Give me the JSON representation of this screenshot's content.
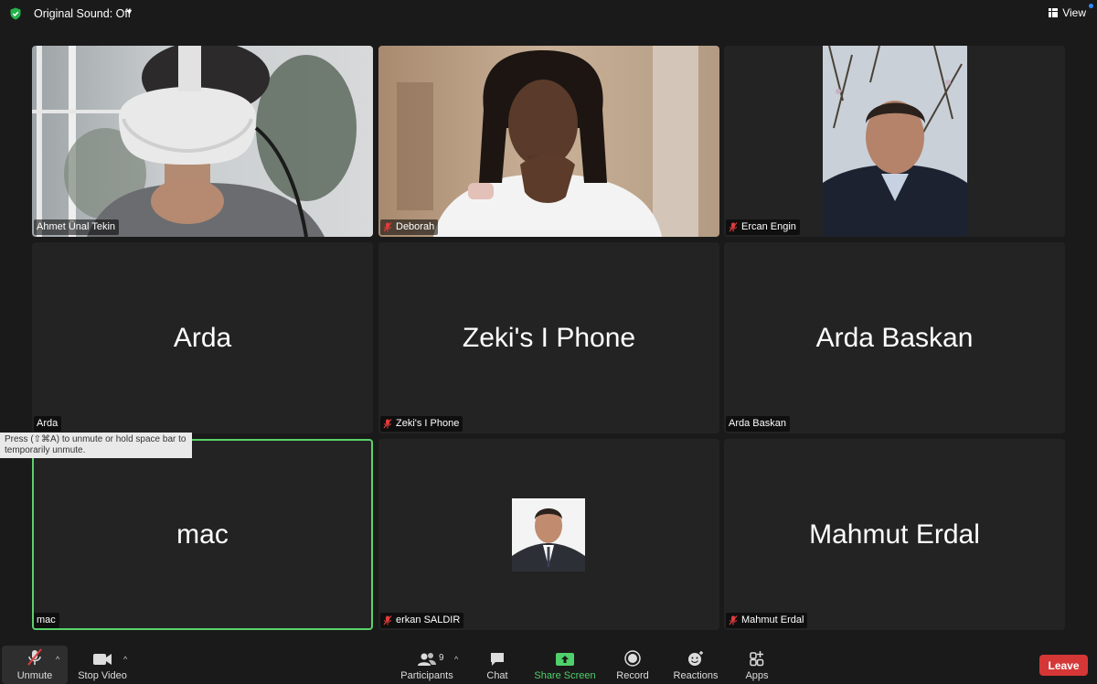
{
  "topbar": {
    "original_sound": "Original Sound: Off",
    "view_label": "View"
  },
  "tiles": [
    {
      "name": "Ahmet Ünal Tekin",
      "muted": false
    },
    {
      "name": "Deborah",
      "muted": true
    },
    {
      "name": "Ercan Engin",
      "muted": true
    },
    {
      "name": "Arda",
      "display": "Arda",
      "muted": false
    },
    {
      "name": "Zeki's I Phone",
      "display": "Zeki's I Phone",
      "muted": true
    },
    {
      "name": "Arda Baskan",
      "display": "Arda Baskan",
      "muted": false
    },
    {
      "name": "mac",
      "display": "mac",
      "muted": false
    },
    {
      "name": "erkan SALDIR",
      "muted": true
    },
    {
      "name": "Mahmut Erdal",
      "display": "Mahmut Erdal",
      "muted": true
    }
  ],
  "tooltip": "Press (⇧⌘A) to unmute or hold space bar to temporarily unmute.",
  "toolbar": {
    "unmute": "Unmute",
    "stop_video": "Stop Video",
    "participants": "Participants",
    "participants_count": "9",
    "chat": "Chat",
    "share_screen": "Share Screen",
    "record": "Record",
    "reactions": "Reactions",
    "apps": "Apps",
    "leave": "Leave"
  },
  "colors": {
    "accent_green": "#4fd06a",
    "leave_red": "#d53737",
    "mic_muted_red": "#e03c3c"
  }
}
